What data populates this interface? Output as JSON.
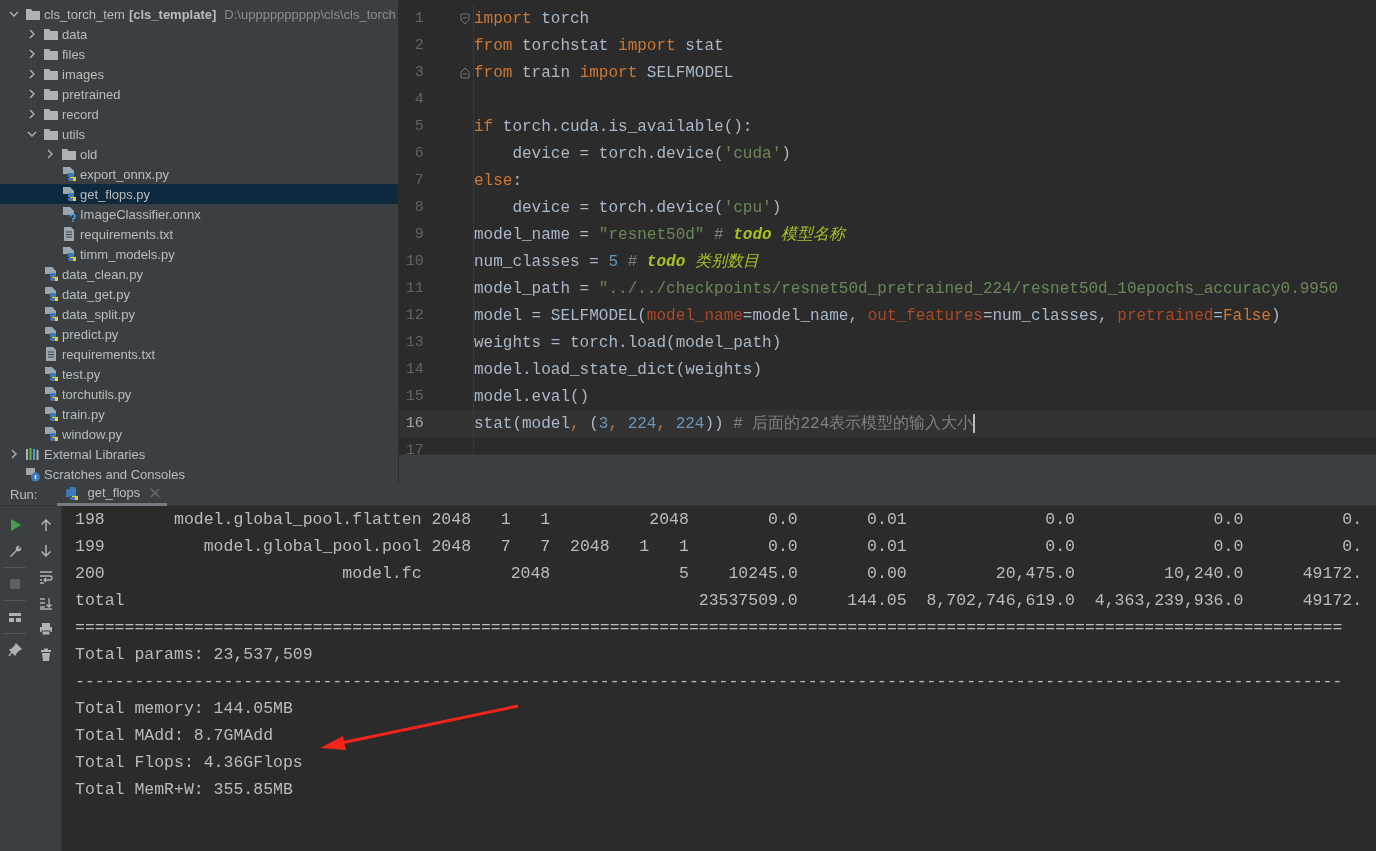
{
  "project_tree": {
    "label": "cls_torch_tem",
    "module": "[cls_template]",
    "path": "D:\\upppppppppp\\cls\\cls_torch",
    "kind": "folder",
    "expanded": true,
    "selected": false,
    "children": [
      {
        "label": "data",
        "kind": "folder",
        "expanded": false,
        "selected": false
      },
      {
        "label": "files",
        "kind": "folder",
        "expanded": false,
        "selected": false
      },
      {
        "label": "images",
        "kind": "folder",
        "expanded": false,
        "selected": false
      },
      {
        "label": "pretrained",
        "kind": "folder",
        "expanded": false,
        "selected": false
      },
      {
        "label": "record",
        "kind": "folder",
        "expanded": false,
        "selected": false
      },
      {
        "label": "utils",
        "kind": "folder",
        "expanded": true,
        "selected": false,
        "children": [
          {
            "label": "old",
            "kind": "folder",
            "expanded": false,
            "selected": false
          },
          {
            "label": "export_onnx.py",
            "kind": "python",
            "selected": false
          },
          {
            "label": "get_flops.py",
            "kind": "python",
            "selected": true
          },
          {
            "label": "ImageClassifier.onnx",
            "kind": "unknown",
            "selected": false
          },
          {
            "label": "requirements.txt",
            "kind": "text",
            "selected": false
          },
          {
            "label": "timm_models.py",
            "kind": "python",
            "selected": false
          }
        ]
      },
      {
        "label": "data_clean.py",
        "kind": "python",
        "selected": false
      },
      {
        "label": "data_get.py",
        "kind": "python",
        "selected": false
      },
      {
        "label": "data_split.py",
        "kind": "python",
        "selected": false
      },
      {
        "label": "predict.py",
        "kind": "python",
        "selected": false
      },
      {
        "label": "requirements.txt",
        "kind": "text",
        "selected": false
      },
      {
        "label": "test.py",
        "kind": "python",
        "selected": false
      },
      {
        "label": "torchutils.py",
        "kind": "python",
        "selected": false
      },
      {
        "label": "train.py",
        "kind": "python",
        "selected": false
      },
      {
        "label": "window.py",
        "kind": "python",
        "selected": false
      }
    ]
  },
  "extra_tree_items": [
    {
      "label": "External Libraries",
      "kind": "libraries",
      "expanded": false,
      "selected": false
    },
    {
      "label": "Scratches and Consoles",
      "kind": "scratches",
      "selected": false
    }
  ],
  "editor": {
    "lines": [
      {
        "number": "1",
        "fold_start": true,
        "tokens": [
          {
            "kind": "keyword",
            "text": "import"
          },
          {
            "kind": "plain",
            "text": " torch"
          }
        ]
      },
      {
        "number": "2",
        "tokens": [
          {
            "kind": "keyword",
            "text": "from"
          },
          {
            "kind": "plain",
            "text": " torchstat "
          },
          {
            "kind": "keyword",
            "text": "import"
          },
          {
            "kind": "plain",
            "text": " stat"
          }
        ]
      },
      {
        "number": "3",
        "fold_end": true,
        "tokens": [
          {
            "kind": "keyword",
            "text": "from"
          },
          {
            "kind": "plain",
            "text": " train "
          },
          {
            "kind": "keyword",
            "text": "import"
          },
          {
            "kind": "plain",
            "text": " SELFMODEL"
          }
        ]
      },
      {
        "number": "4"
      },
      {
        "number": "5",
        "tokens": [
          {
            "kind": "keyword",
            "text": "if"
          },
          {
            "kind": "plain",
            "text": " torch.cuda.is_available():"
          }
        ]
      },
      {
        "number": "6",
        "tokens": [
          {
            "kind": "plain",
            "text": "    device = torch.device("
          },
          {
            "kind": "string",
            "text": "'cuda'"
          },
          {
            "kind": "plain",
            "text": ")"
          }
        ]
      },
      {
        "number": "7",
        "tokens": [
          {
            "kind": "keyword",
            "text": "else"
          },
          {
            "kind": "plain",
            "text": ":"
          }
        ]
      },
      {
        "number": "8",
        "tokens": [
          {
            "kind": "plain",
            "text": "    device = torch.device("
          },
          {
            "kind": "string",
            "text": "'cpu'"
          },
          {
            "kind": "plain",
            "text": ")"
          }
        ]
      },
      {
        "number": "9",
        "tokens": [
          {
            "kind": "plain",
            "text": "model_name = "
          },
          {
            "kind": "string",
            "text": "\"resnet50d\""
          },
          {
            "kind": "comment",
            "text": " # "
          },
          {
            "kind": "todo",
            "text": "todo"
          },
          {
            "kind": "todo_text",
            "text": " 模型名称"
          }
        ]
      },
      {
        "number": "10",
        "tokens": [
          {
            "kind": "plain",
            "text": "num_classes = "
          },
          {
            "kind": "number",
            "text": "5"
          },
          {
            "kind": "comment",
            "text": " # "
          },
          {
            "kind": "todo",
            "text": "todo"
          },
          {
            "kind": "todo_text",
            "text": " 类别数目"
          }
        ]
      },
      {
        "number": "11",
        "tokens": [
          {
            "kind": "plain",
            "text": "model_path = "
          },
          {
            "kind": "string",
            "text": "\"../../checkpoints/resnet50d_pretrained_224/resnet50d_10epochs_accuracy0.9950"
          }
        ]
      },
      {
        "number": "12",
        "tokens": [
          {
            "kind": "plain",
            "text": "model = SELFMODEL("
          },
          {
            "kind": "param",
            "text": "model_name"
          },
          {
            "kind": "plain",
            "text": "=model_name, "
          },
          {
            "kind": "param",
            "text": "out_features"
          },
          {
            "kind": "plain",
            "text": "=num_classes, "
          },
          {
            "kind": "param",
            "text": "pretrained"
          },
          {
            "kind": "plain",
            "text": "="
          },
          {
            "kind": "keyword",
            "text": "False"
          },
          {
            "kind": "plain",
            "text": ")"
          }
        ]
      },
      {
        "number": "13",
        "tokens": [
          {
            "kind": "plain",
            "text": "weights = torch.load(model_path)"
          }
        ]
      },
      {
        "number": "14",
        "tokens": [
          {
            "kind": "plain",
            "text": "model.load_state_dict(weights)"
          }
        ]
      },
      {
        "number": "15",
        "tokens": [
          {
            "kind": "plain",
            "text": "model.eval()"
          }
        ]
      },
      {
        "number": "16",
        "current": true,
        "caret": true,
        "tokens": [
          {
            "kind": "plain",
            "text": "stat(model"
          },
          {
            "kind": "keyword",
            "text": ", "
          },
          {
            "kind": "plain",
            "text": "("
          },
          {
            "kind": "number",
            "text": "3"
          },
          {
            "kind": "keyword",
            "text": ", "
          },
          {
            "kind": "number",
            "text": "224"
          },
          {
            "kind": "keyword",
            "text": ", "
          },
          {
            "kind": "number",
            "text": "224"
          },
          {
            "kind": "plain",
            "text": ")) "
          },
          {
            "kind": "comment",
            "text": "# 后面的224表示模型的输入大小"
          }
        ]
      },
      {
        "number": "17"
      }
    ]
  },
  "run_bar": {
    "label": "Run:",
    "tabs": [
      {
        "label": "get_flops",
        "selected": true
      }
    ]
  },
  "console": {
    "rows": [
      {
        "kind": "data",
        "column_1": "198",
        "column_2": "model.global_pool.flatten",
        "column_3": "2048   1   1",
        "column_4": "2048",
        "column_5": "0.0",
        "column_6": "0.01",
        "column_7": "0.0",
        "column_8": "0.0",
        "column_9": "0."
      },
      {
        "kind": "data",
        "column_1": "199",
        "column_2": "model.global_pool.pool",
        "column_3": "2048   7   7",
        "column_4": "2048   1   1",
        "column_5": "0.0",
        "column_6": "0.01",
        "column_7": "0.0",
        "column_8": "0.0",
        "column_9": "0."
      },
      {
        "kind": "data",
        "column_1": "200",
        "column_2": "model.fc",
        "column_3": "2048",
        "column_4": "5",
        "column_5": "10245.0",
        "column_6": "0.00",
        "column_7": "20,475.0",
        "column_8": "10,240.0",
        "column_9": "49172."
      },
      {
        "kind": "total",
        "column_1": "total",
        "column_5": "23537509.0",
        "column_6": "144.05",
        "column_7": "8,702,746,619.0",
        "column_8": "4,363,239,936.0",
        "column_9": "49172."
      }
    ],
    "lines": [
      {
        "rule": "================================================================================================================================"
      },
      {
        "text": "Total params: 23,537,509"
      },
      {
        "rule": "--------------------------------------------------------------------------------------------------------------------------------"
      },
      {
        "text": "Total memory: 144.05MB"
      },
      {
        "text": "Total MAdd: 8.7GMAdd"
      },
      {
        "text": "Total Flops: 4.36GFlops"
      },
      {
        "text": "Total MemR+W: 355.85MB"
      }
    ]
  },
  "annotation": {
    "kind": "arrow"
  }
}
